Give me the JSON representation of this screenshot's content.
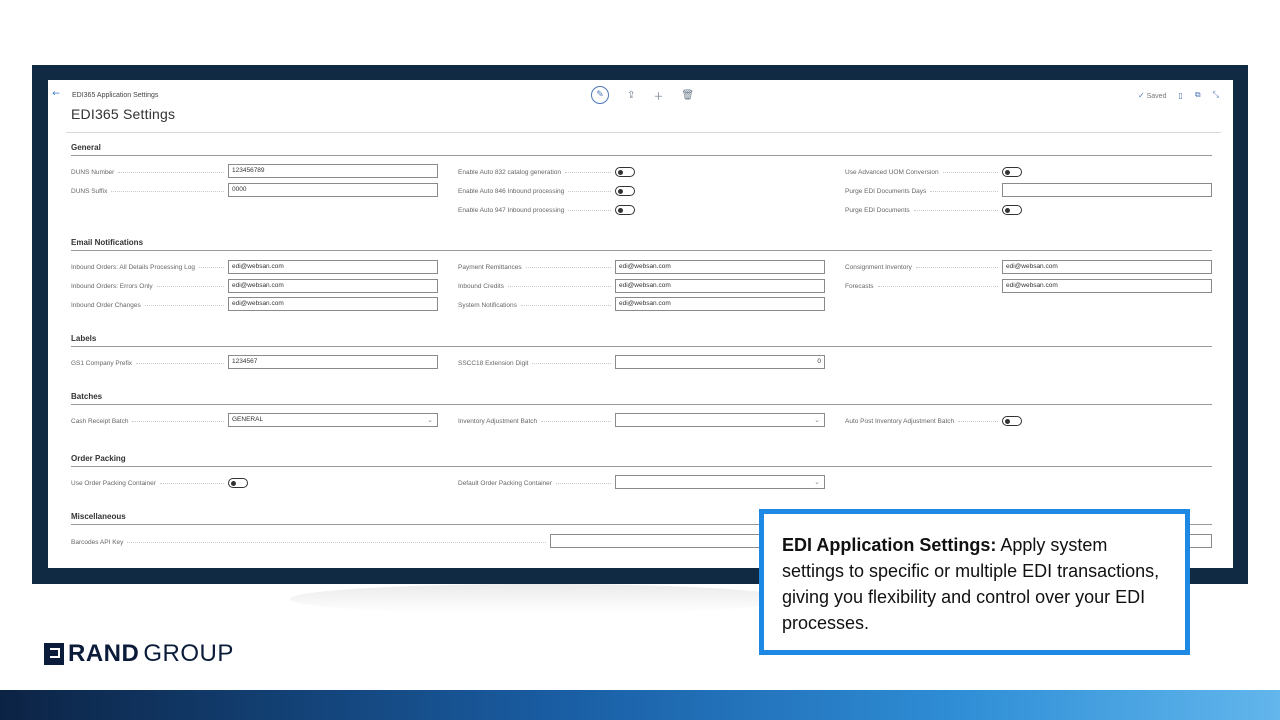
{
  "breadcrumb": "EDI365 Application Settings",
  "page_title": "EDI365 Settings",
  "status": "Saved",
  "sections": {
    "general": "General",
    "email": "Email Notifications",
    "labels": "Labels",
    "batches": "Batches",
    "order_packing": "Order Packing",
    "misc": "Miscellaneous"
  },
  "general": {
    "duns_number_label": "DUNS Number",
    "duns_number_value": "123456789",
    "duns_suffix_label": "DUNS Suffix",
    "duns_suffix_value": "0000",
    "auto832_label": "Enable Auto 832 catalog generation",
    "auto846_label": "Enable Auto 846 Inbound processing",
    "auto947_label": "Enable Auto 947 Inbound processing",
    "adv_uom_label": "Use Advanced UOM Conversion",
    "purge_days_label": "Purge EDI Documents Days",
    "purge_days_value": "",
    "purge_docs_label": "Purge EDI Documents"
  },
  "email": {
    "all_details_label": "Inbound Orders: All Details Processing Log",
    "all_details_value": "edi@websan.com",
    "errors_only_label": "Inbound Orders: Errors Only",
    "errors_only_value": "edi@websan.com",
    "order_changes_label": "Inbound Order Changes",
    "order_changes_value": "edi@websan.com",
    "payment_label": "Payment Remittances",
    "payment_value": "edi@websan.com",
    "credits_label": "Inbound Credits",
    "credits_value": "edi@websan.com",
    "system_label": "System Notifications",
    "system_value": "edi@websan.com",
    "consignment_label": "Consignment Inventory",
    "consignment_value": "edi@websan.com",
    "forecasts_label": "Forecasts",
    "forecasts_value": "edi@websan.com"
  },
  "labels": {
    "gs1_label": "GS1 Company Prefix",
    "gs1_value": "1234567",
    "sscc_label": "SSCC18 Extension Digit",
    "sscc_value": "0"
  },
  "batches": {
    "cash_label": "Cash Receipt Batch",
    "cash_value": "GENERAL",
    "inv_adj_label": "Inventory Adjustment Batch",
    "inv_adj_value": "",
    "auto_post_label": "Auto Post Inventory Adjustment Batch"
  },
  "order_packing": {
    "use_container_label": "Use Order Packing Container",
    "default_container_label": "Default Order Packing Container",
    "default_container_value": ""
  },
  "misc": {
    "barcodes_label": "Barcodes API Key",
    "barcodes_value": ""
  },
  "callout": {
    "heading": "EDI Application Settings:",
    "body": " Apply system settings to specific or multiple EDI transactions, giving you flexibility and control over your EDI processes."
  },
  "logo": {
    "part1": "RAND",
    "part2": "GROUP"
  },
  "icons": [
    "back-arrow-icon",
    "edit-icon",
    "share-icon",
    "add-icon",
    "delete-icon",
    "check-icon",
    "bookmark-icon",
    "open-new-window-icon",
    "collapse-icon",
    "chevron-down-icon",
    "rand-logo-mark"
  ],
  "colors": {
    "frame": "#102a44",
    "accent": "#1e88e5",
    "brand": "#0b1c3a"
  }
}
